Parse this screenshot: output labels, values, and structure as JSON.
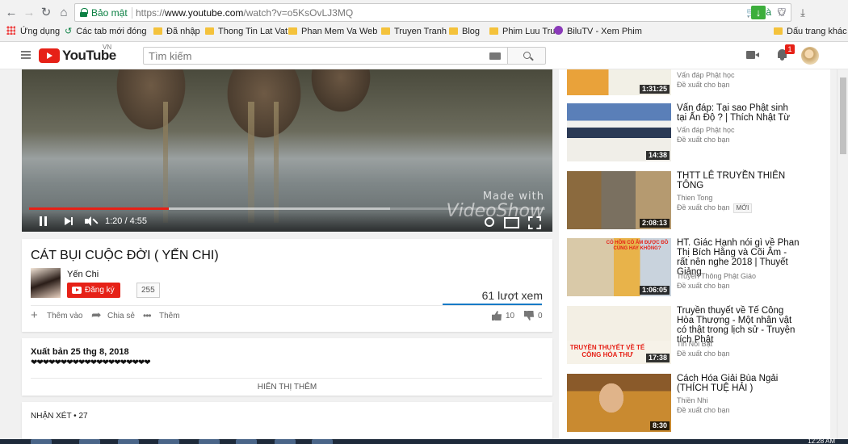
{
  "browser": {
    "secure_label": "Bảo mật",
    "url_scheme": "https://",
    "url_host": "www.youtube.com",
    "url_path": "/watch?v=o5KsOvLJ3MQ",
    "bookmarks": [
      {
        "label": "Ứng dụng",
        "icon": "apps-icon"
      },
      {
        "label": "Các tab mới đóng",
        "icon": "history-icon"
      },
      {
        "label": "Đã nhập",
        "icon": "folder-icon"
      },
      {
        "label": "Thong Tin Lat Vat",
        "icon": "folder-icon"
      },
      {
        "label": "Phan Mem Va Web",
        "icon": "folder-icon"
      },
      {
        "label": "Truyen Tranh",
        "icon": "folder-icon"
      },
      {
        "label": "Blog",
        "icon": "folder-icon"
      },
      {
        "label": "Phim Luu Tru",
        "icon": "folder-icon"
      },
      {
        "label": "BiluTV - Xem Phim",
        "icon": "bilutv-icon"
      },
      {
        "label": "Dấu trang khác",
        "icon": "folder-icon"
      }
    ]
  },
  "header": {
    "logo_text": "YouTube",
    "logo_country": "VN",
    "search_placeholder": "Tìm kiếm",
    "notification_count": "1"
  },
  "player": {
    "current_time": "1:20",
    "duration": "4:55",
    "time_display": "1:20 / 4:55",
    "played_fraction": 0.27,
    "loaded_fraction": 0.7,
    "watermark_line1": "Made with",
    "watermark_line2": "VideoShow"
  },
  "video": {
    "title": "CÁT BỤI CUỘC ĐỜI ( YẾN CHI)",
    "channel": "Yến Chi",
    "subscribe_label": "Đăng ký",
    "subscriber_count": "255",
    "views": "61 lượt xem",
    "actions": [
      {
        "label": "Thêm vào",
        "icon": "plus-icon"
      },
      {
        "label": "Chia sẻ",
        "icon": "share-icon"
      },
      {
        "label": "Thêm",
        "icon": "more-icon"
      }
    ],
    "likes": "10",
    "dislikes": "0"
  },
  "description": {
    "published": "Xuất bản 25 thg 8, 2018",
    "text": "❤❤❤❤❤❤❤❤❤❤❤❤❤❤❤❤❤❤❤❤",
    "show_more": "HIỂN THỊ THÊM"
  },
  "comments": {
    "title": "NHẬN XÉT • 27"
  },
  "recommendations": [
    {
      "title": "",
      "channel": "Vấn đáp Phật học",
      "meta": "Đề xuất cho bạn",
      "duration": "1:31:25",
      "is_new": false
    },
    {
      "title": "Vấn đáp: Tại sao Phật sinh tại Ấn Độ ? | Thích Nhật Từ",
      "channel": "Vấn đáp Phật học",
      "meta": "Đề xuất cho bạn",
      "duration": "14:38",
      "is_new": false
    },
    {
      "title": "THTT LÊ TRUYỀN THIÊN TÔNG",
      "channel": "Thien Tong",
      "meta": "Đề xuất cho bạn",
      "duration": "2:08:13",
      "is_new": true,
      "new_label": "MỚI"
    },
    {
      "title": "HT. Giác Hạnh nói gì về Phan Thị Bích Hằng và Cõi Âm - rất nên nghe 2018 | Thuyết Giảng",
      "channel": "Truyền Thông Phật Giáo",
      "meta": "Đề xuất cho bạn",
      "duration": "1:06:05",
      "is_new": false,
      "thumb_text": "CÓ HỒN CÒ ÂM ĐƯỢC ĐỒ CÚNG HAY KHÔNG?"
    },
    {
      "title": "Truyền thuyết về Tế Công Hòa Thượng - Một nhân vật có thật trong lịch sử - Truyện tích Phật",
      "channel": "Tin Nổi Bật",
      "meta": "Đề xuất cho bạn",
      "duration": "17:38",
      "is_new": false,
      "thumb_text": "TRUYỀN THUYẾT VỀ TẾ CÔNG HÒA THƯ"
    },
    {
      "title": "Cách Hóa Giải Bùa Ngải (THÍCH TUỆ HẢI )",
      "channel": "Thiền Nhi",
      "meta": "Đề xuất cho bạn",
      "duration": "8:30",
      "is_new": false
    }
  ],
  "taskbar": {
    "clock": "12:28 AM"
  },
  "colors": {
    "youtube_red": "#e62117",
    "secure_green": "#0b8043",
    "link_blue": "#167ac6"
  }
}
